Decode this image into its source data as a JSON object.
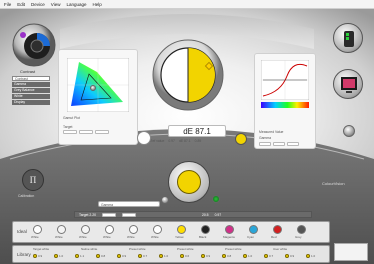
{
  "menu": [
    "File",
    "Edit",
    "Device",
    "View",
    "Language",
    "Help"
  ],
  "left_tabs": [
    "Contrast",
    "Gamma",
    "Grey Balance",
    "White",
    "Display"
  ],
  "gamut_panel": {
    "title": "Gamut Plot",
    "row_labels": [
      "Target",
      "Display"
    ]
  },
  "center": {
    "delta_e": "dE 87.1"
  },
  "graph_panel": {
    "title": "Measured Value",
    "row_labels": [
      "Gamma",
      "Target"
    ]
  },
  "measurement": {
    "mode_label": "Gamma",
    "stats": [
      "Ref value",
      "0.97",
      "dE 87.1",
      "0.89"
    ],
    "mid_label": "Target 2.20",
    "right_stats": [
      "20.5",
      "0.97"
    ]
  },
  "brand": {
    "left_label": "Calibration",
    "right_label": "ColourVision"
  },
  "swatch_rows": {
    "row1_label": "Ideal",
    "row2_label": "Library"
  },
  "swatch_names": [
    "White",
    "White",
    "White",
    "White",
    "White",
    "White",
    "Yellow",
    "Black",
    "Magenta",
    "Cyan",
    "Red",
    "Grey"
  ],
  "swatch_colors": [
    "#ffffff",
    "#f4f4f4",
    "#f6f6f6",
    "#ffffff",
    "#fafafa",
    "#ffffff",
    "#ffde00",
    "#222222",
    "#d03088",
    "#2aa6d8",
    "#d22020",
    "#555555"
  ],
  "library_tags": [
    "Target white",
    "Native white",
    "Preset white",
    "Preset white",
    "Preset white",
    "User white"
  ],
  "library_values": [
    "0.9",
    "1.0",
    "1.1",
    "0.8",
    "0.9",
    "0.7",
    "1.0",
    "0.6",
    "0.9",
    "0.8",
    "1.0",
    "0.7",
    "0.9",
    "1.0"
  ],
  "colors": {
    "accent": "#f2d400",
    "dial_blue": "#1c6bd6"
  }
}
